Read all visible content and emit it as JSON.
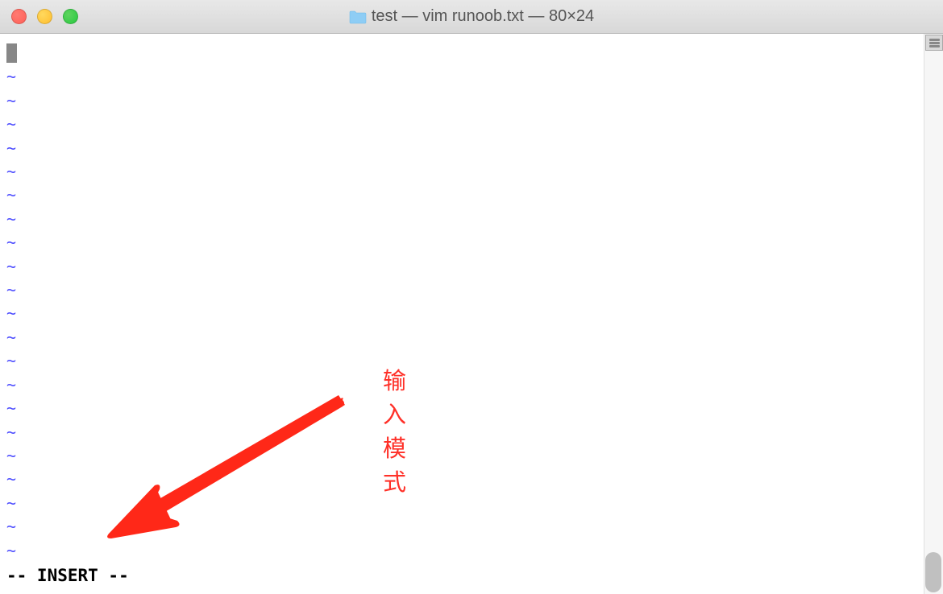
{
  "titlebar": {
    "title": "test — vim runoob.txt — 80×24"
  },
  "editor": {
    "tilde_char": "~",
    "tilde_count": 21,
    "status_text": "-- INSERT --"
  },
  "annotation": {
    "label": "输入模式"
  }
}
